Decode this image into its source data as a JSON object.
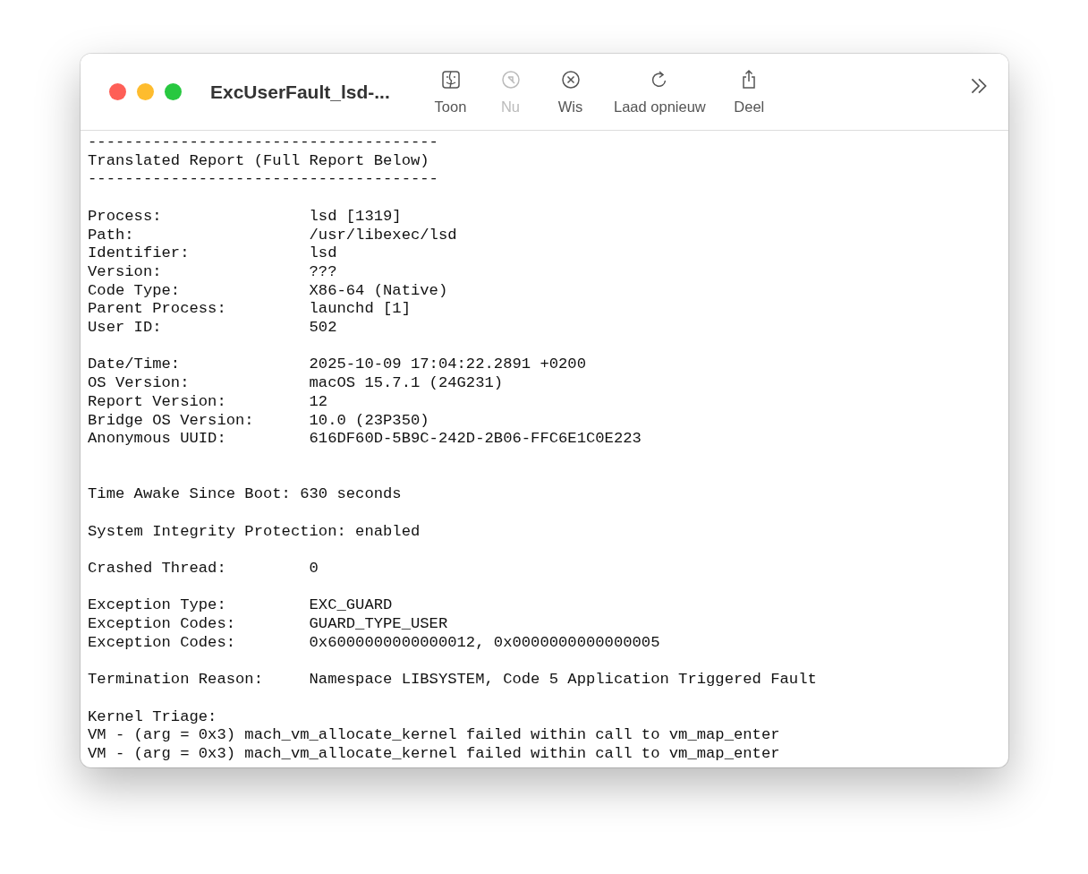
{
  "window": {
    "title": "ExcUserFault_lsd-..."
  },
  "toolbar": [
    {
      "kind": "show",
      "label": "Toon",
      "disabled": false
    },
    {
      "kind": "now",
      "label": "Nu",
      "disabled": true
    },
    {
      "kind": "clear",
      "label": "Wis",
      "disabled": false
    },
    {
      "kind": "reload",
      "label": "Laad opnieuw",
      "disabled": false
    },
    {
      "kind": "share",
      "label": "Deel",
      "disabled": false
    }
  ],
  "report": [
    {
      "extra_space": false,
      "lines": [
        {
          "text": "--------------------------------------"
        },
        {
          "text": "Translated Report (Full Report Below)"
        },
        {
          "text": "--------------------------------------"
        }
      ]
    },
    {
      "extra_space": false,
      "lines": [
        {
          "label": "Process:",
          "value": "lsd [1319]"
        },
        {
          "label": "Path:",
          "value": "/usr/libexec/lsd"
        },
        {
          "label": "Identifier:",
          "value": "lsd"
        },
        {
          "label": "Version:",
          "value": "???"
        },
        {
          "label": "Code Type:",
          "value": "X86-64 (Native)"
        },
        {
          "label": "Parent Process:",
          "value": "launchd [1]"
        },
        {
          "label": "User ID:",
          "value": "502"
        }
      ]
    },
    {
      "extra_space": false,
      "lines": [
        {
          "label": "Date/Time:",
          "value": "2025-10-09 17:04:22.2891 +0200"
        },
        {
          "label": "OS Version:",
          "value": "macOS 15.7.1 (24G231)"
        },
        {
          "label": "Report Version:",
          "value": "12"
        },
        {
          "label": "Bridge OS Version:",
          "value": "10.0 (23P350)"
        },
        {
          "label": "Anonymous UUID:",
          "value": "616DF60D-5B9C-242D-2B06-FFC6E1C0E223"
        }
      ]
    },
    {
      "extra_space": true,
      "lines": [
        {
          "text": "Time Awake Since Boot: 630 seconds"
        }
      ]
    },
    {
      "extra_space": false,
      "lines": [
        {
          "text": "System Integrity Protection: enabled"
        }
      ]
    },
    {
      "extra_space": false,
      "lines": [
        {
          "label": "Crashed Thread:",
          "value": "0"
        }
      ]
    },
    {
      "extra_space": false,
      "lines": [
        {
          "label": "Exception Type:",
          "value": "EXC_GUARD"
        },
        {
          "label": "Exception Codes:",
          "value": "GUARD_TYPE_USER"
        },
        {
          "label": "Exception Codes:",
          "value": "0x6000000000000012, 0x0000000000000005"
        }
      ]
    },
    {
      "extra_space": false,
      "lines": [
        {
          "label": "Termination Reason:",
          "value": "Namespace LIBSYSTEM, Code 5 Application Triggered Fault"
        }
      ]
    },
    {
      "extra_space": false,
      "lines": [
        {
          "text": "Kernel Triage:"
        },
        {
          "text": "VM - (arg = 0x3) mach_vm_allocate_kernel failed within call to vm_map_enter"
        },
        {
          "text": "VM - (arg = 0x3) mach_vm_allocate_kernel failed within call to vm_map_enter"
        }
      ]
    }
  ]
}
